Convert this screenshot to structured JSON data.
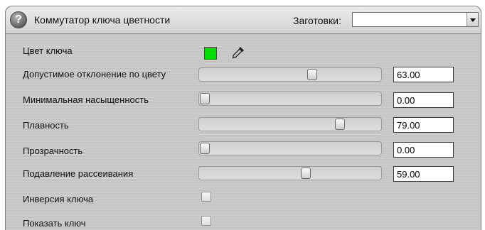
{
  "header": {
    "title": "Коммутатор ключа цветности",
    "help_icon": "question-mark-icon",
    "presets_label": "Заготовки:",
    "presets_value": ""
  },
  "key_color": {
    "label": "Цвет ключа",
    "color": "#00e000",
    "picker_icon": "eyedropper-icon"
  },
  "sliders": [
    {
      "label": "Допустимое отклонение по цвету",
      "value": "63.00",
      "level": 0.63
    },
    {
      "label": "Минимальная насыщенность",
      "value": "0.00",
      "level": 0.0
    },
    {
      "label": "Плавность",
      "value": "79.00",
      "level": 0.79
    },
    {
      "label": "Прозрачность",
      "value": "0.00",
      "level": 0.0
    },
    {
      "label": "Подавление рассеивания",
      "value": "59.00",
      "level": 0.59
    }
  ],
  "checkboxes": [
    {
      "label": "Инверсия ключа",
      "checked": false
    },
    {
      "label": "Показать ключ",
      "checked": false
    }
  ]
}
